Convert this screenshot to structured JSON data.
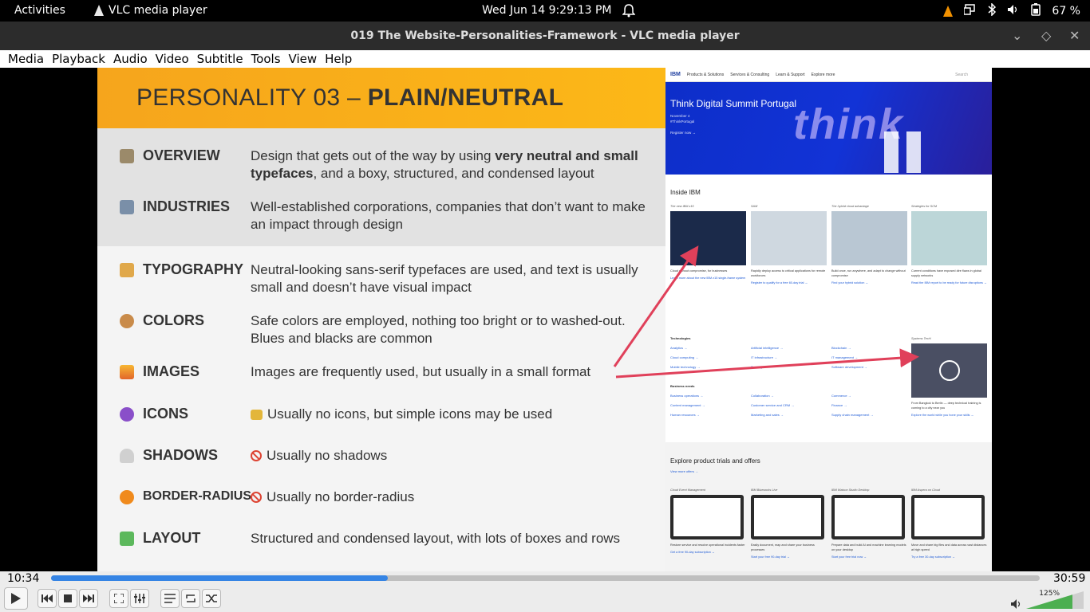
{
  "topbar": {
    "activities": "Activities",
    "app_name": "VLC media player",
    "clock": "Wed Jun 14  9:29:13 PM",
    "battery": "67 %"
  },
  "window": {
    "title": "019 The Website-Personalities-Framework - VLC media player"
  },
  "menu": [
    "Media",
    "Playback",
    "Audio",
    "Video",
    "Subtitle",
    "Tools",
    "View",
    "Help"
  ],
  "slide": {
    "title_prefix": "PERSONALITY 03 – ",
    "title_bold": "PLAIN/NEUTRAL",
    "rows": [
      {
        "label": "OVERVIEW",
        "icon": "notebook-icon",
        "color": "#9b8a6a",
        "desc_a": "Design that gets out of the way by using ",
        "desc_b": "very neutral and small typefaces",
        "desc_c": ", and a boxy, structured, and condensed layout"
      },
      {
        "label": "INDUSTRIES",
        "icon": "bank-icon",
        "color": "#7a8fa8",
        "desc": "Well-established corporations, companies that don’t want to make an impact through design"
      },
      {
        "label": "TYPOGRAPHY",
        "icon": "writing-hand-icon",
        "color": "#e0a84a",
        "desc": "Neutral-looking sans-serif typefaces are used, and text is usually small and doesn’t have visual impact"
      },
      {
        "label": "COLORS",
        "icon": "palette-icon",
        "color": "#c98b4a",
        "desc": "Safe colors are employed, nothing too bright or to washed-out. Blues and blacks are common"
      },
      {
        "label": "IMAGES",
        "icon": "sunset-image-icon",
        "color": "#e2662a",
        "desc": "Images are frequently used, but usually in a small format"
      },
      {
        "label": "ICONS",
        "icon": "atom-icon",
        "color": "#8a4fc9",
        "desc": "Usually no icons, but simple icons may be used"
      },
      {
        "label": "SHADOWS",
        "icon": "ghost-icon",
        "color": "#bbbbbb",
        "desc": "Usually no shadows"
      },
      {
        "label": "BORDER-RADIUS",
        "icon": "orange-circle-icon",
        "color": "#f08a1c",
        "desc": "Usually no border-radius"
      },
      {
        "label": "LAYOUT",
        "icon": "puzzle-icon",
        "color": "#5cb85c",
        "desc": "Structured and condensed layout, with lots of boxes and rows"
      }
    ]
  },
  "ibm": {
    "logo": "IBM",
    "nav": [
      "Products & Solutions",
      "Services & Consulting",
      "Learn & Support",
      "Explore more"
    ],
    "search": "Search",
    "hero_title": "Think Digital Summit Portugal",
    "hero_sub1": "November 4",
    "hero_sub2": "#ThinkPortugal",
    "hero_link": "Register now →",
    "hero_word": "think",
    "inside": "Inside IBM",
    "cards": [
      {
        "cap": "The new IBM z15",
        "txt": "Cloud without compromise, for businesses",
        "lnk": "Learn more about the new IBM z15 single-frame system →",
        "bg": "#1b2a4a"
      },
      {
        "cap": "SAM",
        "txt": "Rapidly deploy access to critical applications for remote workforces",
        "lnk": "Register to qualify for a free 60-day trial →",
        "bg": "#cfd8e0"
      },
      {
        "cap": "The hybrid cloud advantage",
        "txt": "Build once, run anywhere, and adapt to change without compromise",
        "lnk": "Find your hybrid solution →",
        "bg": "#b9c7d3"
      },
      {
        "cap": "Strategies for SCM",
        "txt": "Current conditions have exposed dire flaws in global supply networks",
        "lnk": "Read the IBM report to be ready for future disruptions →",
        "bg": "#bcd6d8"
      }
    ],
    "tech_title": "Technologies",
    "tech_cols": [
      [
        "Analytics →",
        "Cloud computing →",
        "Mobile technology →"
      ],
      [
        "Artificial intelligence →",
        "IT infrastructure →",
        "Security →"
      ],
      [
        "Blockchain →",
        "IT management →",
        "Software development →"
      ]
    ],
    "biz_title": "Business needs",
    "biz_cols": [
      [
        "Business operations →",
        "Content management →",
        "Human resources →"
      ],
      [
        "Collaboration →",
        "Customer service and CRM →",
        "Marketing and sales →"
      ],
      [
        "Commerce →",
        "Finance →",
        "Supply chain management →"
      ]
    ],
    "video_cap": "Systems Tech!",
    "video_txt": "From Bangkok to Berlin — deep technical training is coming to a city near you",
    "video_lnk": "Explore the world while you hone your skills →",
    "offers_title": "Explore product trials and offers",
    "offers_link": "View more offers →",
    "offers": [
      {
        "cap": "Cloud Event Management",
        "txt": "Restore service and resolve operational incidents faster",
        "lnk": "Get a free 90-day subscription →"
      },
      {
        "cap": "IBM Blueworks Live",
        "txt": "Easily document, map and share your business processes",
        "lnk": "Start your free 90-day trial →"
      },
      {
        "cap": "IBM Watson Studio Desktop",
        "txt": "Prepare data and build AI and machine learning models on your desktop",
        "lnk": "Start your free trial now →"
      },
      {
        "cap": "IBM Aspera on Cloud",
        "txt": "Move and share big files and data across vast distances at high speed",
        "lnk": "Try a free 30-day subscription →"
      }
    ]
  },
  "player": {
    "elapsed": "10:34",
    "total": "30:59",
    "progress": 0.341,
    "volume": "125%"
  }
}
